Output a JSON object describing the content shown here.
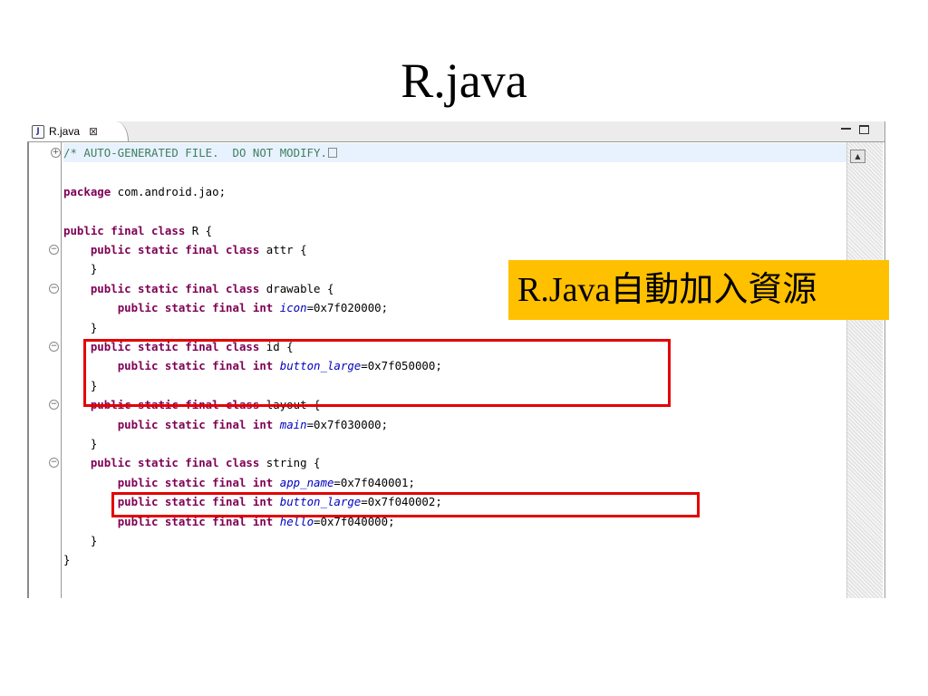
{
  "slide": {
    "title": "R.java",
    "callout_text": "R.Java自動加入資源"
  },
  "editor": {
    "tab": {
      "icon_letter": "J",
      "label": "R.java",
      "close_glyph": "⊠"
    },
    "window_controls": [
      "minimize-icon",
      "maximize-icon"
    ],
    "scroll_up_glyph": "▲",
    "lines": [
      {
        "fold": "+",
        "tokens": [
          {
            "t": "cm",
            "s": "/* AUTO-GENERATED FILE.  DO NOT MODIFY."
          }
        ],
        "folded": true,
        "highlight": true
      },
      {
        "fold": "",
        "tokens": []
      },
      {
        "fold": "",
        "tokens": [
          {
            "t": "kw",
            "s": "package"
          },
          {
            "t": "",
            "s": " com.android.jao;"
          }
        ]
      },
      {
        "fold": "",
        "tokens": []
      },
      {
        "fold": "",
        "tokens": [
          {
            "t": "kw",
            "s": "public final class"
          },
          {
            "t": "",
            "s": " R {"
          }
        ]
      },
      {
        "fold": "−",
        "tokens": [
          {
            "t": "",
            "s": "    "
          },
          {
            "t": "kw",
            "s": "public static final class"
          },
          {
            "t": "",
            "s": " attr {"
          }
        ]
      },
      {
        "fold": "",
        "tokens": [
          {
            "t": "",
            "s": "    }"
          }
        ]
      },
      {
        "fold": "−",
        "tokens": [
          {
            "t": "",
            "s": "    "
          },
          {
            "t": "kw",
            "s": "public static final class"
          },
          {
            "t": "",
            "s": " drawable {"
          }
        ]
      },
      {
        "fold": "",
        "tokens": [
          {
            "t": "",
            "s": "        "
          },
          {
            "t": "kw",
            "s": "public static final int"
          },
          {
            "t": "",
            "s": " "
          },
          {
            "t": "fld",
            "s": "icon"
          },
          {
            "t": "",
            "s": "=0x7f020000;"
          }
        ]
      },
      {
        "fold": "",
        "tokens": [
          {
            "t": "",
            "s": "    }"
          }
        ]
      },
      {
        "fold": "−",
        "tokens": [
          {
            "t": "",
            "s": "    "
          },
          {
            "t": "kw",
            "s": "public static final class"
          },
          {
            "t": "",
            "s": " id {"
          }
        ]
      },
      {
        "fold": "",
        "tokens": [
          {
            "t": "",
            "s": "        "
          },
          {
            "t": "kw",
            "s": "public static final int"
          },
          {
            "t": "",
            "s": " "
          },
          {
            "t": "fld",
            "s": "button_large"
          },
          {
            "t": "",
            "s": "=0x7f050000;"
          }
        ]
      },
      {
        "fold": "",
        "tokens": [
          {
            "t": "",
            "s": "    }"
          }
        ]
      },
      {
        "fold": "−",
        "tokens": [
          {
            "t": "",
            "s": "    "
          },
          {
            "t": "kw",
            "s": "public static final class"
          },
          {
            "t": "",
            "s": " layout {"
          }
        ]
      },
      {
        "fold": "",
        "tokens": [
          {
            "t": "",
            "s": "        "
          },
          {
            "t": "kw",
            "s": "public static final int"
          },
          {
            "t": "",
            "s": " "
          },
          {
            "t": "fld",
            "s": "main"
          },
          {
            "t": "",
            "s": "=0x7f030000;"
          }
        ]
      },
      {
        "fold": "",
        "tokens": [
          {
            "t": "",
            "s": "    }"
          }
        ]
      },
      {
        "fold": "−",
        "tokens": [
          {
            "t": "",
            "s": "    "
          },
          {
            "t": "kw",
            "s": "public static final class"
          },
          {
            "t": "",
            "s": " string {"
          }
        ]
      },
      {
        "fold": "",
        "tokens": [
          {
            "t": "",
            "s": "        "
          },
          {
            "t": "kw",
            "s": "public static final int"
          },
          {
            "t": "",
            "s": " "
          },
          {
            "t": "fld",
            "s": "app_name"
          },
          {
            "t": "",
            "s": "=0x7f040001;"
          }
        ]
      },
      {
        "fold": "",
        "tokens": [
          {
            "t": "",
            "s": "        "
          },
          {
            "t": "kw",
            "s": "public static final int"
          },
          {
            "t": "",
            "s": " "
          },
          {
            "t": "fld",
            "s": "button_large"
          },
          {
            "t": "",
            "s": "=0x7f040002;"
          }
        ]
      },
      {
        "fold": "",
        "tokens": [
          {
            "t": "",
            "s": "        "
          },
          {
            "t": "kw",
            "s": "public static final int"
          },
          {
            "t": "",
            "s": " "
          },
          {
            "t": "fld",
            "s": "hello"
          },
          {
            "t": "",
            "s": "=0x7f040000;"
          }
        ]
      },
      {
        "fold": "",
        "tokens": [
          {
            "t": "",
            "s": "    }"
          }
        ]
      },
      {
        "fold": "",
        "tokens": [
          {
            "t": "",
            "s": "}"
          }
        ]
      }
    ]
  },
  "colors": {
    "keyword": "#7f0055",
    "comment": "#3f7f5f",
    "field": "#0000c0",
    "highlight_box": "#e30000",
    "callout_bg": "#ffc000"
  }
}
